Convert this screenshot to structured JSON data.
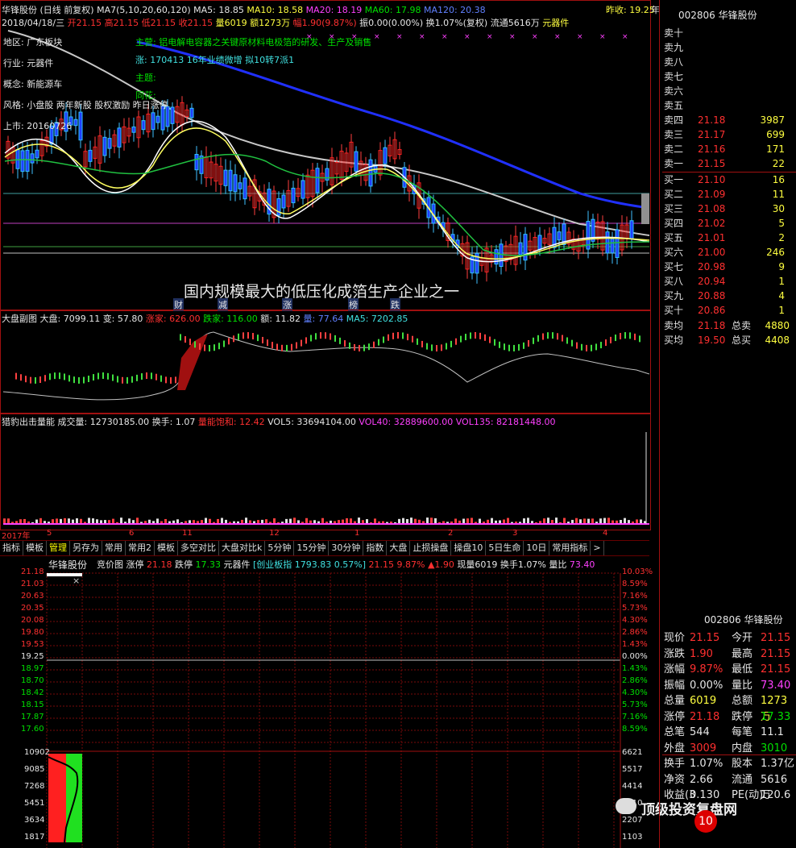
{
  "kline_header": {
    "line1": [
      {
        "t": "华锋股份 (日线 前复权) MA7(5,10,20,60,120)",
        "c": "wht"
      },
      {
        "t": "MA5: 18.85",
        "c": "wht"
      },
      {
        "t": "MA10: 18.58",
        "c": "yel"
      },
      {
        "t": "MA20: 18.19",
        "c": "mag"
      },
      {
        "t": "MA60: 17.98",
        "c": "grn"
      },
      {
        "t": "MA120: 20.38",
        "c": "blu"
      }
    ],
    "prev_close": "昨收: 19.25",
    "year_label": "年",
    "line2": [
      {
        "t": "2018/04/18/三",
        "c": "wht"
      },
      {
        "t": "开21.15",
        "c": "red"
      },
      {
        "t": "高21.15",
        "c": "red"
      },
      {
        "t": "低21.15",
        "c": "red"
      },
      {
        "t": "收21.15",
        "c": "red"
      },
      {
        "t": "量6019",
        "c": "yel"
      },
      {
        "t": "额1273万",
        "c": "yel"
      },
      {
        "t": "幅1.90(9.87%)",
        "c": "red"
      },
      {
        "t": "振0.00(0.00%)",
        "c": "wht"
      },
      {
        "t": "换1.07%(复权)",
        "c": "wht"
      },
      {
        "t": "流通5616万",
        "c": "wht"
      },
      {
        "t": "元器件",
        "c": "yel"
      }
    ]
  },
  "info_overlay": [
    {
      "t": "地区: 广东板块",
      "c": "wht"
    },
    {
      "t": "行业: 元器件",
      "c": "wht"
    },
    {
      "t": "概念: 新能源车",
      "c": "wht"
    },
    {
      "t": "风格: 小盘股 两年新股 股权激励 昨日涨停",
      "c": "wht"
    },
    {
      "t": "上市: 20160726",
      "c": "wht"
    }
  ],
  "info_overlay2": [
    {
      "t": "主营: 铝电解电容器之关键原材料电极箔的研发、生产及销售",
      "c": "grn"
    },
    {
      "t": "涨: 170413 16年业绩微增 拟10转7派1",
      "c": "cyn"
    },
    {
      "t": "主题:",
      "c": "grn"
    },
    {
      "t": "同花:",
      "c": "grn"
    }
  ],
  "banner": "国内规模最大的低压化成箔生产企业之一",
  "kline_marks": [
    "财",
    "减",
    "涨",
    "榜",
    "跌"
  ],
  "index_panel": {
    "label": "大盘副图 大盘:",
    "vals": [
      {
        "t": "7099.11",
        "c": "wht"
      },
      {
        "t": "变: 57.80",
        "c": "wht"
      },
      {
        "t": "涨家: 626.00",
        "c": "red"
      },
      {
        "t": "跌家: 116.00",
        "c": "grn"
      },
      {
        "t": "额: 11.82",
        "c": "wht"
      },
      {
        "t": "量: 77.64",
        "c": "blu"
      },
      {
        "t": "MA5: 7202.85",
        "c": "cyn"
      }
    ]
  },
  "vol_panel": {
    "label": "猎豹出击量能 成交量: 12730185.00",
    "vals": [
      {
        "t": "换手: 1.07",
        "c": "wht"
      },
      {
        "t": "量能饱和: 12.42",
        "c": "red"
      },
      {
        "t": "VOL5: 33694104.00",
        "c": "wht"
      },
      {
        "t": "VOL40: 32889600.00",
        "c": "mag"
      },
      {
        "t": "VOL135: 82181448.00",
        "c": "mag"
      }
    ]
  },
  "date_axis": [
    "2017年",
    "5",
    "6",
    "11",
    "12",
    "1",
    "2",
    "3",
    "4"
  ],
  "tabs": [
    "指标",
    "模板",
    "管理",
    "另存为",
    "常用",
    "常用2",
    "模板",
    "多空对比",
    "大盘对比k",
    "5分钟",
    "15分钟",
    "30分钟",
    "指数",
    "大盘",
    "止损操盘",
    "操盘10",
    "5日生命",
    "10日",
    "常用指标",
    ">"
  ],
  "auction": {
    "title": "华锋股份",
    "line": [
      {
        "t": "竞价图 涨停",
        "c": "wht"
      },
      {
        "t": "21.18",
        "c": "red"
      },
      {
        "t": "跌停",
        "c": "wht"
      },
      {
        "t": "17.33",
        "c": "grn"
      },
      {
        "t": "元器件",
        "c": "wht"
      },
      {
        "t": "[创业板指",
        "c": "cyn"
      },
      {
        "t": "1793.83",
        "c": "cyn"
      },
      {
        "t": "0.57%]",
        "c": "cyn"
      },
      {
        "t": "21.15",
        "c": "red"
      },
      {
        "t": "9.87%",
        "c": "red"
      },
      {
        "t": "▲1.90",
        "c": "red"
      },
      {
        "t": "现量6019 换手1.07% 量比",
        "c": "wht"
      },
      {
        "t": "73.40",
        "c": "mag"
      }
    ],
    "left_prices": [
      "21.18",
      "21.03",
      "20.63",
      "20.35",
      "20.08",
      "19.80",
      "19.53",
      "19.25",
      "18.97",
      "18.70",
      "18.42",
      "18.15",
      "17.87",
      "17.60"
    ],
    "right_pcts": [
      "10.03%",
      "8.59%",
      "7.16%",
      "5.73%",
      "4.30%",
      "2.86%",
      "1.43%",
      "0.00%",
      "1.43%",
      "2.86%",
      "4.30%",
      "5.73%",
      "7.16%",
      "8.59%"
    ],
    "left_vols": [
      "10902",
      "9085",
      "7268",
      "5451",
      "3634",
      "1817"
    ],
    "right_vols": [
      "6621",
      "5517",
      "4414",
      "3310",
      "2207",
      "1103"
    ]
  },
  "orderbook": {
    "sells": [
      {
        "l": "卖十",
        "p": "",
        "v": ""
      },
      {
        "l": "卖九",
        "p": "",
        "v": ""
      },
      {
        "l": "卖八",
        "p": "",
        "v": ""
      },
      {
        "l": "卖七",
        "p": "",
        "v": ""
      },
      {
        "l": "卖六",
        "p": "",
        "v": ""
      },
      {
        "l": "卖五",
        "p": "",
        "v": ""
      },
      {
        "l": "卖四",
        "p": "21.18",
        "v": "3987"
      },
      {
        "l": "卖三",
        "p": "21.17",
        "v": "699"
      },
      {
        "l": "卖二",
        "p": "21.16",
        "v": "171"
      },
      {
        "l": "卖一",
        "p": "21.15",
        "v": "22"
      }
    ],
    "buys": [
      {
        "l": "买一",
        "p": "21.10",
        "v": "16"
      },
      {
        "l": "买二",
        "p": "21.09",
        "v": "11"
      },
      {
        "l": "买三",
        "p": "21.08",
        "v": "30"
      },
      {
        "l": "买四",
        "p": "21.02",
        "v": "5"
      },
      {
        "l": "买五",
        "p": "21.01",
        "v": "2"
      },
      {
        "l": "买六",
        "p": "21.00",
        "v": "246"
      },
      {
        "l": "买七",
        "p": "20.98",
        "v": "9"
      },
      {
        "l": "买八",
        "p": "20.94",
        "v": "1"
      },
      {
        "l": "买九",
        "p": "20.88",
        "v": "4"
      },
      {
        "l": "买十",
        "p": "20.86",
        "v": "1"
      }
    ],
    "avg": [
      {
        "l": "卖均",
        "p": "21.18",
        "l2": "总卖",
        "v": "4880"
      },
      {
        "l": "买均",
        "p": "19.50",
        "l2": "总买",
        "v": "4408"
      }
    ],
    "code_title": "002806 华锋股份"
  },
  "quote": {
    "title": "002806 华锋股份",
    "rows": [
      {
        "a": "现价",
        "av": "21.15",
        "ac": "red",
        "b": "今开",
        "bv": "21.15",
        "bc": "red"
      },
      {
        "a": "涨跌",
        "av": "1.90",
        "ac": "red",
        "b": "最高",
        "bv": "21.15",
        "bc": "red"
      },
      {
        "a": "涨幅",
        "av": "9.87%",
        "ac": "red",
        "b": "最低",
        "bv": "21.15",
        "bc": "red"
      },
      {
        "a": "振幅",
        "av": "0.00%",
        "ac": "wht",
        "b": "量比",
        "bv": "73.40",
        "bc": "mag"
      },
      {
        "a": "总量",
        "av": "6019",
        "ac": "yel",
        "b": "总额",
        "bv": "1273万",
        "bc": "yel"
      },
      {
        "a": "涨停",
        "av": "21.18",
        "ac": "red",
        "b": "跌停",
        "bv": "17.33",
        "bc": "grn"
      },
      {
        "a": "总笔",
        "av": "544",
        "ac": "wht",
        "b": "每笔",
        "bv": "11.1",
        "bc": "wht"
      },
      {
        "a": "外盘",
        "av": "3009",
        "ac": "red",
        "b": "内盘",
        "bv": "3010",
        "bc": "grn"
      },
      {
        "a": "换手",
        "av": "1.07%",
        "ac": "wht",
        "b": "股本",
        "bv": "1.37亿",
        "bc": "wht"
      },
      {
        "a": "净资",
        "av": "2.66",
        "ac": "wht",
        "b": "流通",
        "bv": "5616万",
        "bc": "wht"
      },
      {
        "a": "收益(3",
        "av": "0.130",
        "ac": "wht",
        "b": "PE(动)",
        "bv": "120.6",
        "bc": "wht"
      }
    ]
  },
  "watermark": "顶级投资复盘网",
  "watermark_logo": "10Huang.cn"
}
